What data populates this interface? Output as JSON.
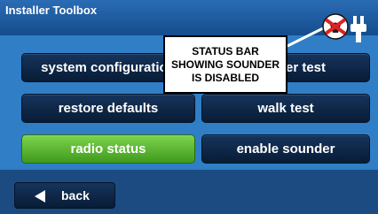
{
  "window": {
    "title": "Installer Toolbox"
  },
  "buttons": {
    "system_configuration": "system configuration",
    "sounder_test": "sounder test",
    "restore_defaults": "restore defaults",
    "walk_test": "walk test",
    "radio_status": "radio status",
    "enable_sounder": "enable sounder"
  },
  "footer": {
    "back_label": "back"
  },
  "callout": {
    "lines": [
      "STATUS BAR",
      "SHOWING SOUNDER",
      "IS DISABLED"
    ]
  },
  "status_icons": [
    "sounder-disabled-icon",
    "power-plug-icon"
  ],
  "colors": {
    "title_bar": "#1d5ea6",
    "panel": "#2f7ec6",
    "button_dark": "#0c2444",
    "button_active": "#5cb634",
    "callout_border": "#000000",
    "disabled_mark": "#e02020"
  }
}
